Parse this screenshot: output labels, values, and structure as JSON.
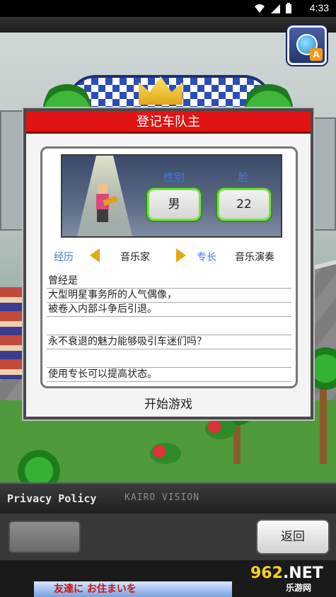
{
  "status_bar": {
    "time": "4:33",
    "icons": [
      "wifi-icon",
      "signal-icon",
      "battery-icon"
    ]
  },
  "translate_button": {
    "icon": "translate-icon",
    "badge": "A"
  },
  "dialog": {
    "title": "登记车队主",
    "gender_label": "性别",
    "gender_value": "男",
    "face_label": "脸",
    "face_value": "22",
    "career_label": "经历",
    "career_value": "音乐家",
    "specialty_label": "专长",
    "specialty_value": "音乐演奏",
    "description_lines": [
      "曾经是",
      "大型明星事务所的人气偶像，",
      "被卷入内部斗争后引退。",
      "",
      "永不衰退的魅力能够吸引车迷们吗？",
      "",
      "使用专长可以提高状态。"
    ],
    "start_button": "开始游戏"
  },
  "footer": {
    "privacy_policy": "Privacy Policy",
    "brand": "KAIRO VISION"
  },
  "bottom_bar": {
    "back_button": "返回"
  },
  "ad": {
    "text": "友達に お住まいを"
  },
  "watermark": {
    "brand": "962",
    "suffix": ".NET",
    "sub": "乐游网"
  },
  "colors": {
    "title_bar": "#e01414",
    "stat_border": "#7ae04a",
    "label_blue": "#3b7be0",
    "arrow": "#e2a913"
  }
}
